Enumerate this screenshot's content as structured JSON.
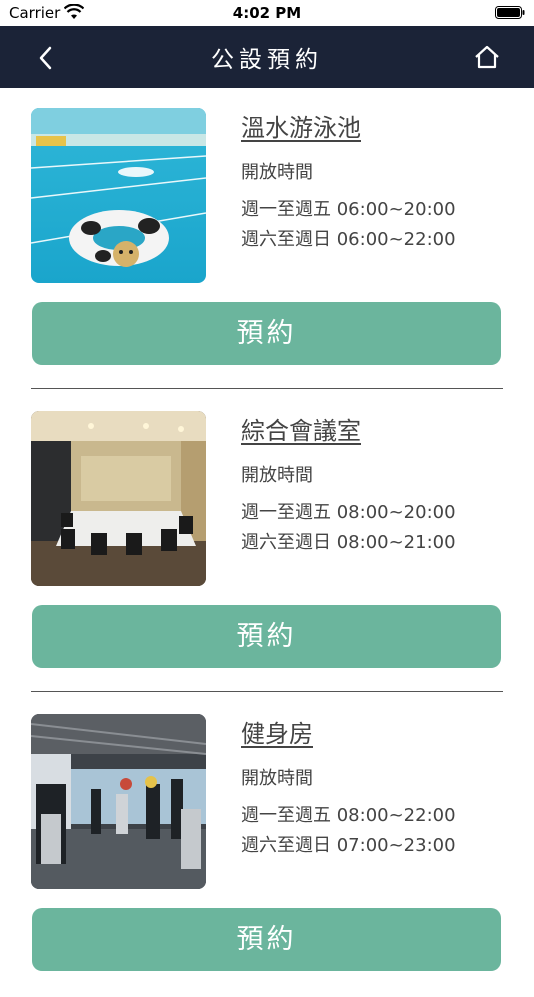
{
  "status_bar": {
    "carrier": "Carrier",
    "time": "4:02 PM"
  },
  "navbar": {
    "title": "公設預約",
    "back_icon": "chevron-left-icon",
    "home_icon": "home-icon"
  },
  "facilities": [
    {
      "name": "溫水游泳池",
      "hours_label": "開放時間",
      "weekday_hours": "週一至週五 06:00~20:00",
      "weekend_hours": "週六至週日 06:00~22:00",
      "button_label": "預約"
    },
    {
      "name": "綜合會議室",
      "hours_label": "開放時間",
      "weekday_hours": "週一至週五 08:00~20:00",
      "weekend_hours": "週六至週日 08:00~21:00",
      "button_label": "預約"
    },
    {
      "name": "健身房",
      "hours_label": "開放時間",
      "weekday_hours": "週一至週五 08:00~22:00",
      "weekend_hours": "週六至週日 07:00~23:00",
      "button_label": "預約"
    }
  ],
  "colors": {
    "navbar": "#1b2337",
    "button": "#6bb59d"
  }
}
